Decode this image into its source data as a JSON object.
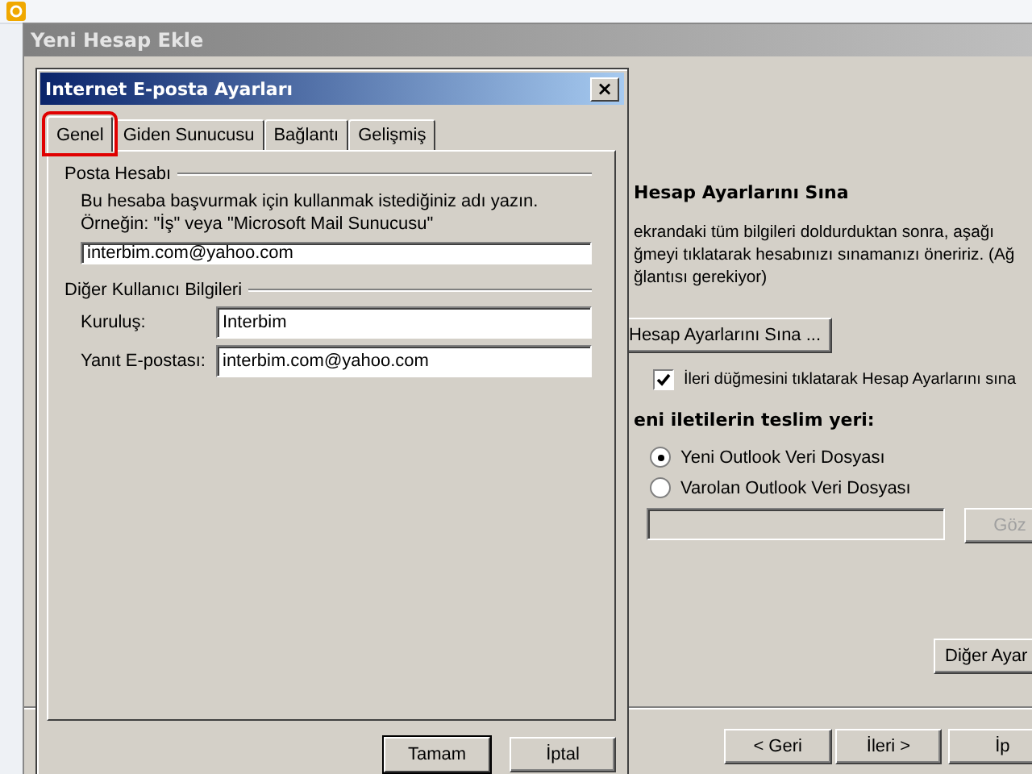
{
  "wizard": {
    "title": "Yeni Hesap Ekle",
    "section_title": "Hesap Ayarlarını Sına",
    "description": [
      "ekrandaki tüm bilgileri doldurduktan sonra, aşağı",
      "ğmeyi tıklatarak hesabınızı sınamanızı öneririz. (Ağ",
      "ğlantısı gerekiyor)"
    ],
    "test_button": "Hesap Ayarlarını Sına ...",
    "auto_test": {
      "label": "İleri düğmesini tıklatarak Hesap Ayarlarını sına",
      "checked": true
    },
    "delivery_title": "eni iletilerin teslim yeri:",
    "delivery_options": [
      {
        "label": "Yeni Outlook Veri Dosyası",
        "selected": true
      },
      {
        "label": "Varolan Outlook Veri Dosyası",
        "selected": false
      }
    ],
    "browse_button": {
      "label": "Göz",
      "disabled": true
    },
    "more_button": "Diğer Ayar",
    "nav_buttons": [
      "< Geri",
      "İleri >",
      "İp"
    ]
  },
  "dialog": {
    "title": "Internet E-posta Ayarları",
    "close": "×",
    "tabs": [
      {
        "label": "Genel",
        "selected": true
      },
      {
        "label": "Giden Sunucusu",
        "selected": false
      },
      {
        "label": "Bağlantı",
        "selected": false
      },
      {
        "label": "Gelişmiş",
        "selected": false
      }
    ],
    "account_group": {
      "title": "Posta Hesabı",
      "hint": [
        "Bu hesaba başvurmak için kullanmak istediğiniz adı yazın.",
        "Örneğin: \"İş\" veya \"Microsoft Mail Sunucusu\""
      ],
      "value": "interbim.com@yahoo.com"
    },
    "user_group": {
      "title": "Diğer Kullanıcı Bilgileri",
      "fields": [
        {
          "label": "Kuruluş:",
          "value": "Interbim"
        },
        {
          "label": "Yanıt E-postası:",
          "value": "interbim.com@yahoo.com"
        }
      ]
    },
    "buttons": [
      "Tamam",
      "İptal"
    ]
  }
}
